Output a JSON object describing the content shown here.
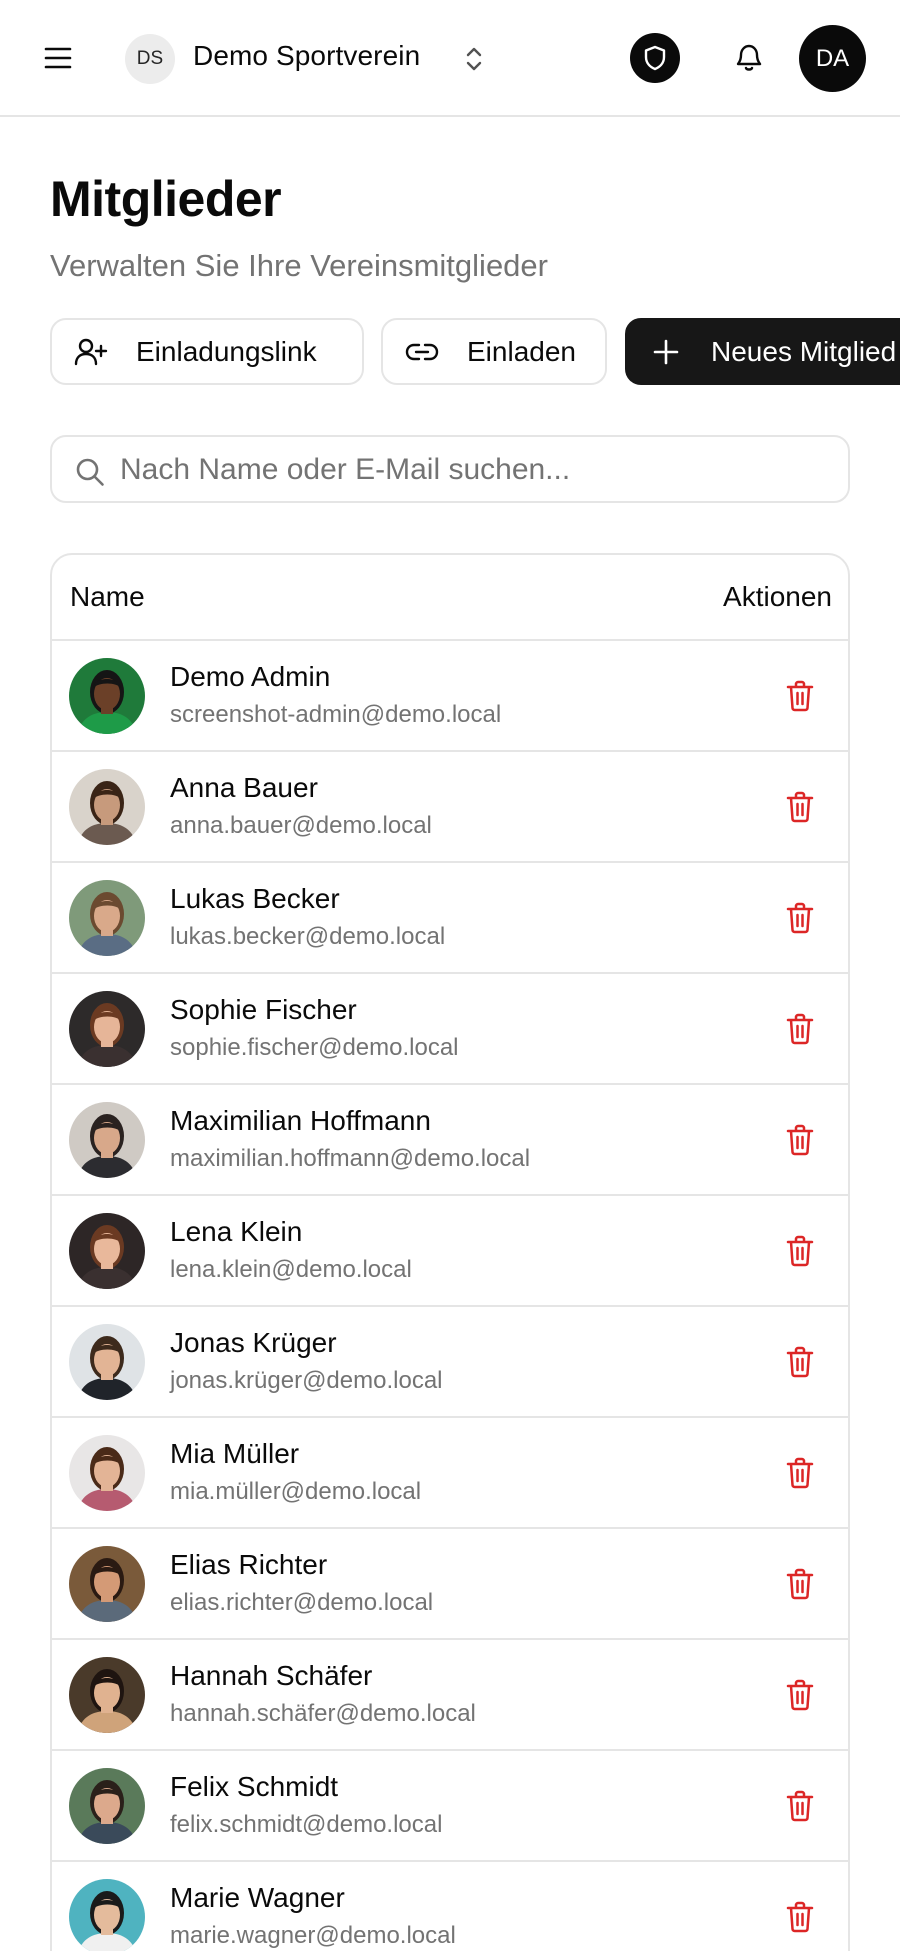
{
  "header": {
    "org_initials": "DS",
    "org_name": "Demo Sportverein",
    "user_initials": "DA"
  },
  "page": {
    "title": "Mitglieder",
    "subtitle": "Verwalten Sie Ihre Vereinsmitglieder"
  },
  "actions": {
    "invite_link_label": "Einladungslink",
    "invite_label": "Einladen",
    "new_member_label": "Neues Mitglied"
  },
  "search": {
    "placeholder": "Nach Name oder E-Mail suchen...",
    "value": ""
  },
  "table": {
    "columns": [
      "Name",
      "Aktionen"
    ],
    "rows": [
      {
        "name": "Demo Admin",
        "email": "screenshot-admin@demo.local",
        "avatar_bg": "#1f7a3a",
        "avatar_skin": "#6b4028",
        "avatar_hair": "#151515",
        "avatar_shirt": "#1e9b48"
      },
      {
        "name": "Anna Bauer",
        "email": "anna.bauer@demo.local",
        "avatar_bg": "#d9d3cb",
        "avatar_skin": "#c79a7c",
        "avatar_hair": "#3a2416",
        "avatar_shirt": "#6b5a50"
      },
      {
        "name": "Lukas Becker",
        "email": "lukas.becker@demo.local",
        "avatar_bg": "#7f9a7a",
        "avatar_skin": "#d9a98a",
        "avatar_hair": "#6b4a30",
        "avatar_shirt": "#5a6d84"
      },
      {
        "name": "Sophie Fischer",
        "email": "sophie.fischer@demo.local",
        "avatar_bg": "#2d2a2a",
        "avatar_skin": "#e6b598",
        "avatar_hair": "#6b3a22",
        "avatar_shirt": "#3a3030"
      },
      {
        "name": "Maximilian Hoffmann",
        "email": "maximilian.hoffmann@demo.local",
        "avatar_bg": "#cfcac4",
        "avatar_skin": "#d8a88a",
        "avatar_hair": "#2a2220",
        "avatar_shirt": "#2c2c30"
      },
      {
        "name": "Lena Klein",
        "email": "lena.klein@demo.local",
        "avatar_bg": "#2d2626",
        "avatar_skin": "#e9b89b",
        "avatar_hair": "#6b3a22",
        "avatar_shirt": "#3a3030"
      },
      {
        "name": "Jonas Krüger",
        "email": "jonas.krüger@demo.local",
        "avatar_bg": "#dfe3e6",
        "avatar_skin": "#e2b495",
        "avatar_hair": "#3d2a1c",
        "avatar_shirt": "#20242a"
      },
      {
        "name": "Mia Müller",
        "email": "mia.müller@demo.local",
        "avatar_bg": "#e8e6e6",
        "avatar_skin": "#e3b496",
        "avatar_hair": "#4a2a18",
        "avatar_shirt": "#b65b70"
      },
      {
        "name": "Elias Richter",
        "email": "elias.richter@demo.local",
        "avatar_bg": "#7a5a3a",
        "avatar_skin": "#d49a76",
        "avatar_hair": "#2a1a12",
        "avatar_shirt": "#5b6a7a"
      },
      {
        "name": "Hannah Schäfer",
        "email": "hannah.schäfer@demo.local",
        "avatar_bg": "#4a3a2a",
        "avatar_skin": "#e0b290",
        "avatar_hair": "#1e1410",
        "avatar_shirt": "#cfa37a"
      },
      {
        "name": "Felix Schmidt",
        "email": "felix.schmidt@demo.local",
        "avatar_bg": "#5a7a5a",
        "avatar_skin": "#dca98c",
        "avatar_hair": "#2a201a",
        "avatar_shirt": "#3a4a5a"
      },
      {
        "name": "Marie Wagner",
        "email": "marie.wagner@demo.local",
        "avatar_bg": "#4fb3c0",
        "avatar_skin": "#e4bb9c",
        "avatar_hair": "#1a1a1a",
        "avatar_shirt": "#f0f0f0"
      }
    ]
  },
  "colors": {
    "accent_dark": "#171717",
    "delete_red": "#dc2626",
    "muted_text": "#737373",
    "border": "#e5e5e5"
  },
  "icons": {
    "menu": "menu-icon",
    "org_switch": "chevrons-up-down-icon",
    "admin": "shield-icon",
    "notifications": "bell-icon",
    "invite_link": "user-plus-icon",
    "invite": "link-icon",
    "new_member": "plus-icon",
    "search": "search-icon",
    "delete": "trash-icon"
  }
}
